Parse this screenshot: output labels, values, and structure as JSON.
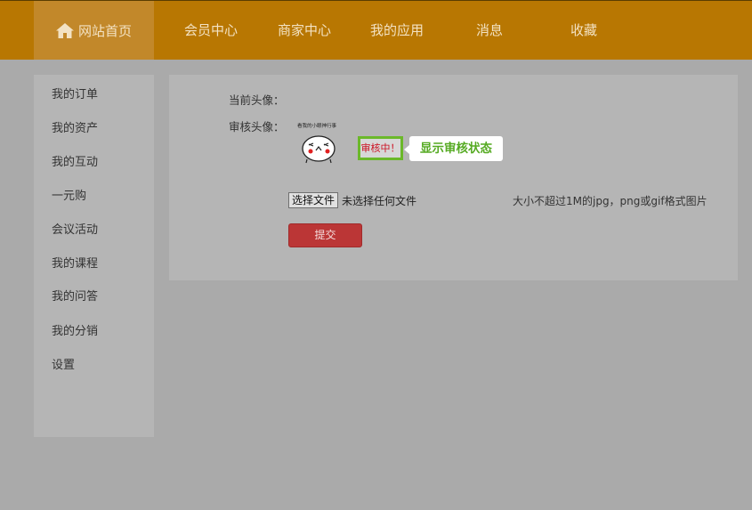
{
  "nav": {
    "home_label": "网站首页",
    "items": [
      {
        "label": "会员中心"
      },
      {
        "label": "商家中心"
      },
      {
        "label": "我的应用"
      },
      {
        "label": "消息"
      },
      {
        "label": "收藏"
      }
    ]
  },
  "sidebar": {
    "items": [
      {
        "label": "我的订单"
      },
      {
        "label": "我的资产"
      },
      {
        "label": "我的互动"
      },
      {
        "label": "一元购"
      },
      {
        "label": "会议活动"
      },
      {
        "label": "我的课程"
      },
      {
        "label": "我的问答"
      },
      {
        "label": "我的分销"
      },
      {
        "label": "设置"
      }
    ]
  },
  "profile": {
    "current_avatar_label": "当前头像：",
    "review_avatar_label": "审核头像：",
    "avatar_caption": "看我的小眼神行事",
    "status_text": "审核中！",
    "callout_text": "显示审核状态",
    "file_button_label": "选择文件",
    "file_status": "未选择任何文件",
    "file_hint": "大小不超过1M的jpg，png或gif格式图片",
    "submit_label": "提交"
  },
  "colors": {
    "header": "#b87702",
    "status_border": "#6bb82a",
    "status_text": "#cc1122",
    "submit": "#bb3636"
  }
}
